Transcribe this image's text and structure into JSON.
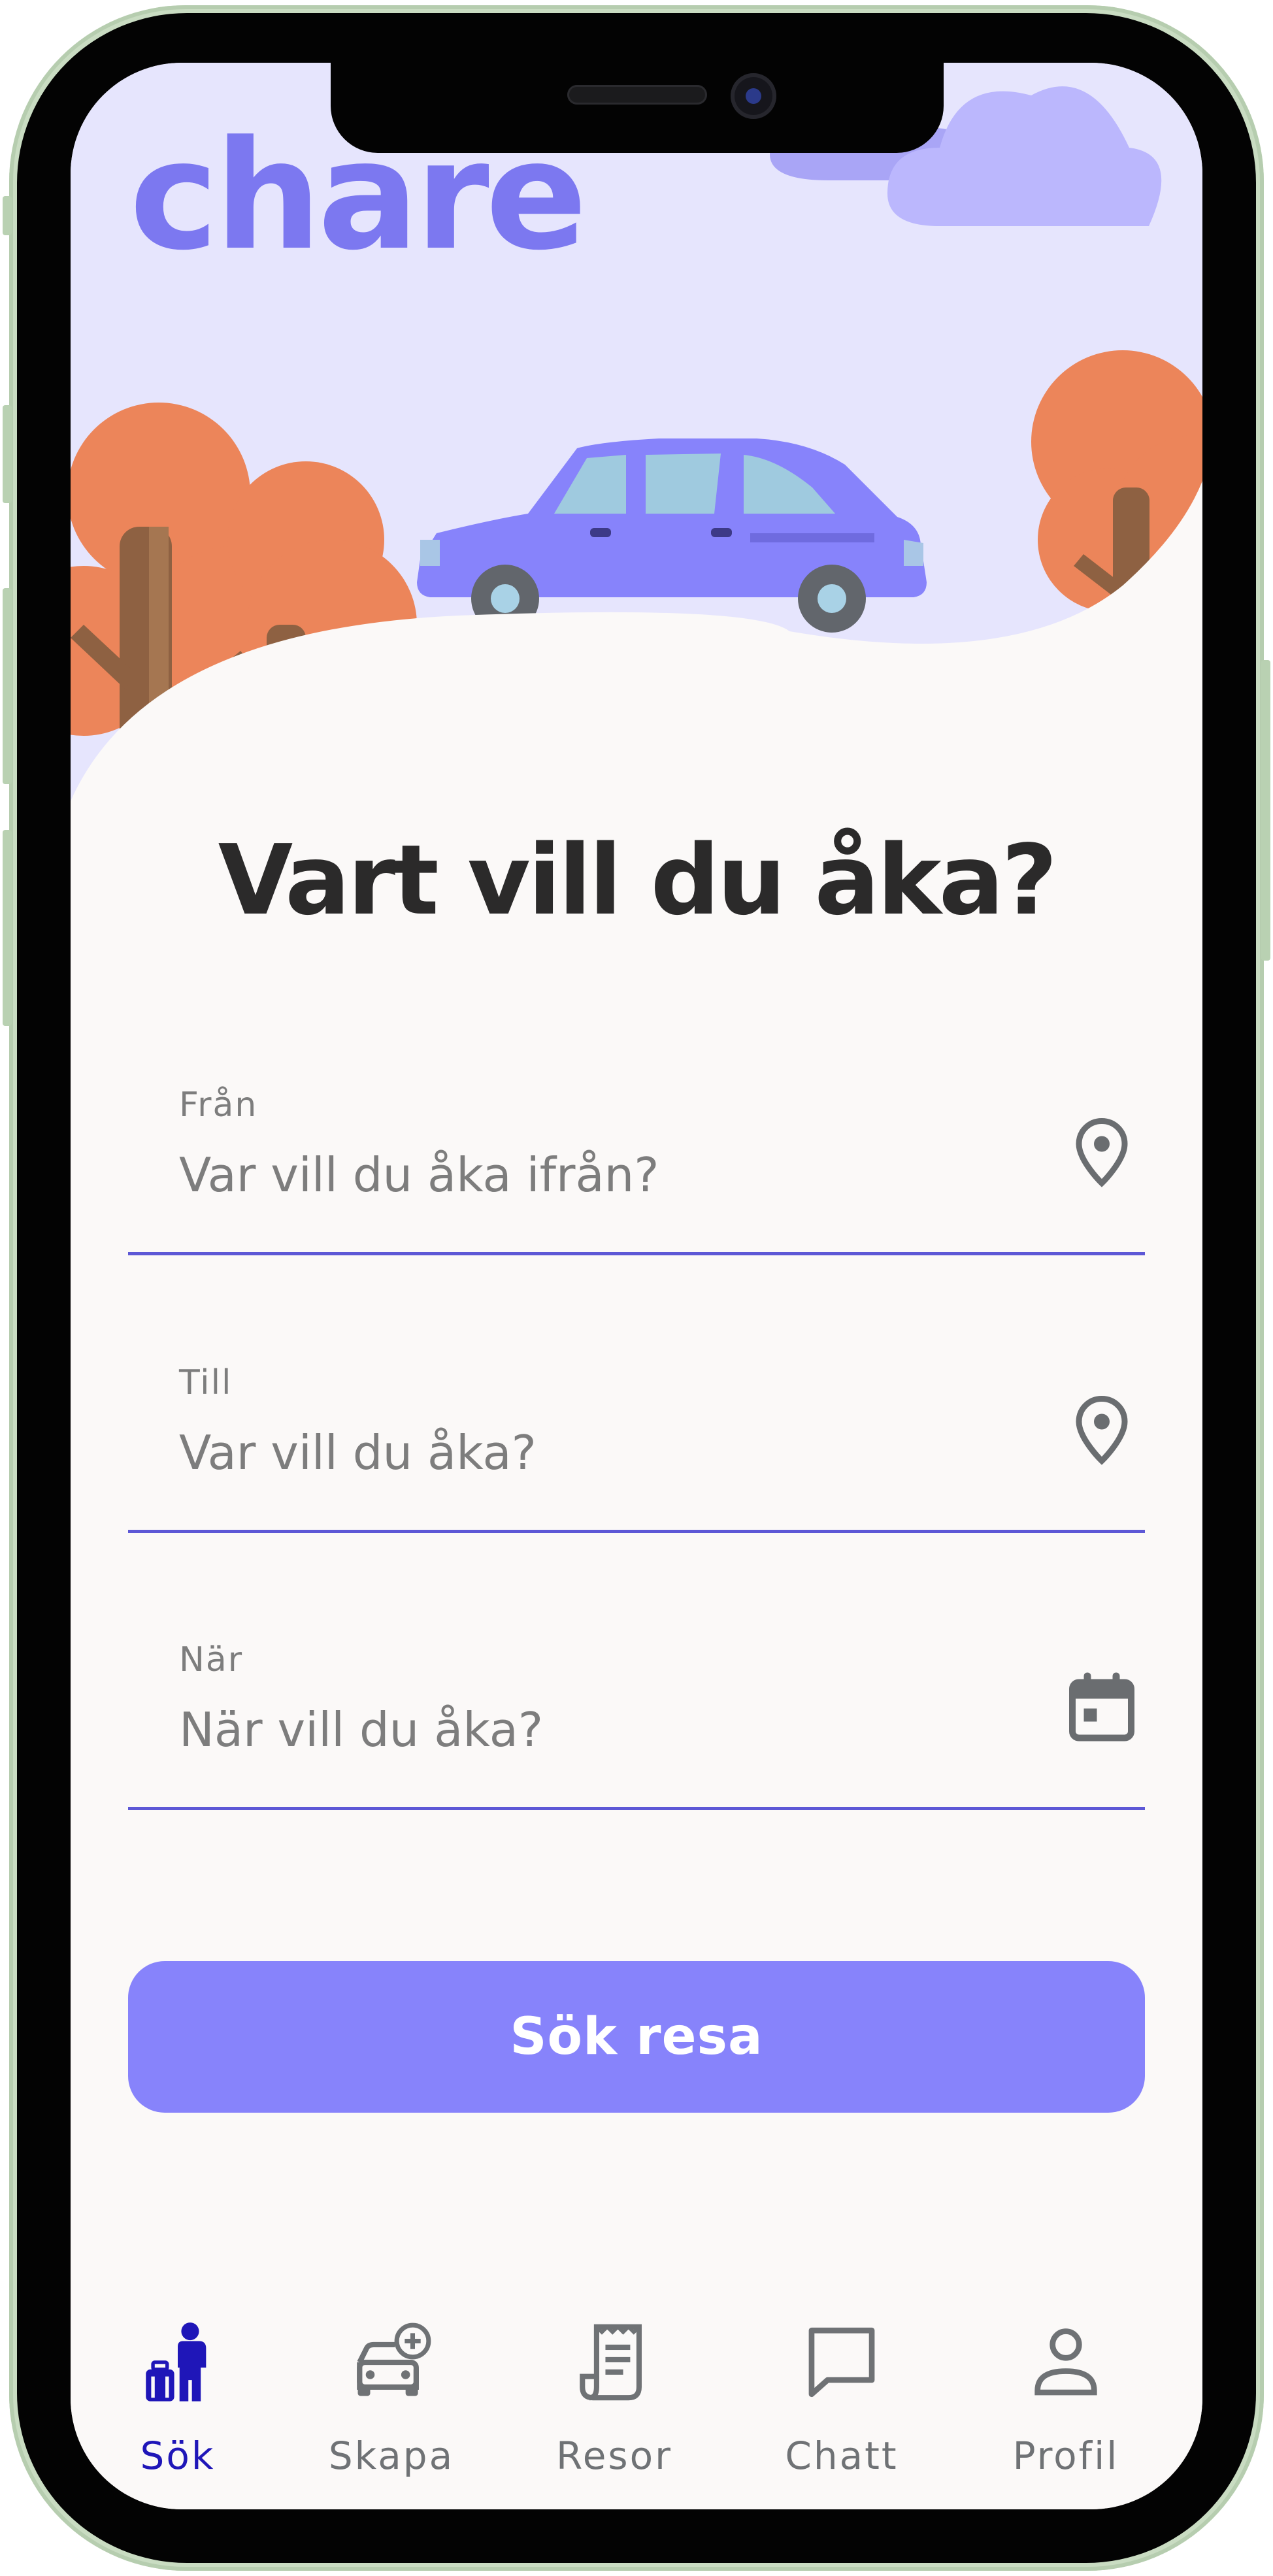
{
  "app": {
    "logo_text": "chare",
    "heading": "Vart vill du åka?"
  },
  "colors": {
    "accent": "#5d58d6",
    "button": "#8783fb",
    "logo": "#7c78f0",
    "sky": "#e6e5fd",
    "tree": "#ec855a",
    "nav_active": "#1f16b8",
    "nav_inactive": "#6f7275",
    "text": "#2b2a2a",
    "muted": "#7d7d7d"
  },
  "form": {
    "from": {
      "label": "Från",
      "placeholder": "Var vill du åka ifrån?",
      "icon": "location-pin-icon"
    },
    "to": {
      "label": "Till",
      "placeholder": "Var vill du åka?",
      "icon": "location-pin-icon"
    },
    "when": {
      "label": "När",
      "placeholder": "När vill du åka?",
      "icon": "calendar-icon"
    }
  },
  "search_button": {
    "label": "Sök resa"
  },
  "nav": {
    "active": "Sök",
    "items": [
      {
        "label": "Sök",
        "icon": "traveler-luggage-icon"
      },
      {
        "label": "Skapa",
        "icon": "car-add-icon"
      },
      {
        "label": "Resor",
        "icon": "receipt-icon"
      },
      {
        "label": "Chatt",
        "icon": "chat-bubble-icon"
      },
      {
        "label": "Profil",
        "icon": "person-icon"
      }
    ]
  }
}
